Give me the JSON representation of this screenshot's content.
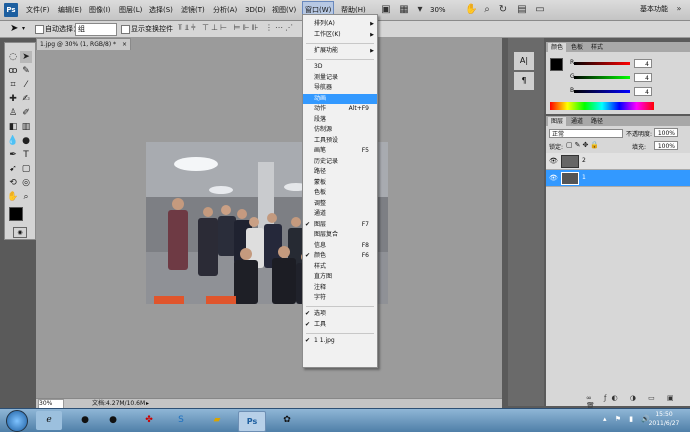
{
  "menubar": {
    "logo": "Ps",
    "items": [
      {
        "label": "文件(F)"
      },
      {
        "label": "编辑(E)"
      },
      {
        "label": "图像(I)"
      },
      {
        "label": "图层(L)"
      },
      {
        "label": "选择(S)"
      },
      {
        "label": "滤镜(T)"
      },
      {
        "label": "分析(A)"
      },
      {
        "label": "3D(D)"
      },
      {
        "label": "视图(V)"
      },
      {
        "label": "窗口(W)",
        "active": true
      },
      {
        "label": "帮助(H)"
      }
    ],
    "zoom": "30%",
    "workspace": "基本功能"
  },
  "options_bar": {
    "auto_select_label": "自动选择：",
    "auto_select_value": "组",
    "show_transform_label": "显示变换控件"
  },
  "document": {
    "tab_title": "1.jpg @ 30% (1, RGB/8) *",
    "zoom_status": "30%",
    "file_info": "文档:4.27M/10.6M"
  },
  "window_menu": {
    "items": [
      {
        "label": "排列(A)",
        "submenu": true
      },
      {
        "label": "工作区(K)",
        "submenu": true
      },
      {
        "separator": true
      },
      {
        "label": "扩展功能",
        "submenu": true
      },
      {
        "separator": true
      },
      {
        "label": "3D"
      },
      {
        "label": "测量记录"
      },
      {
        "label": "导航器"
      },
      {
        "label": "动画",
        "highlighted": true
      },
      {
        "label": "动作",
        "shortcut": "Alt+F9"
      },
      {
        "label": "段落"
      },
      {
        "label": "仿制源"
      },
      {
        "label": "工具预设"
      },
      {
        "label": "画笔",
        "shortcut": "F5"
      },
      {
        "label": "历史记录"
      },
      {
        "label": "路径"
      },
      {
        "label": "蒙板"
      },
      {
        "label": "色板"
      },
      {
        "label": "调整"
      },
      {
        "label": "通道"
      },
      {
        "label": "图层",
        "checked": true,
        "shortcut": "F7"
      },
      {
        "label": "图层复合"
      },
      {
        "label": "信息",
        "shortcut": "F8"
      },
      {
        "label": "颜色",
        "checked": true,
        "shortcut": "F6"
      },
      {
        "label": "样式"
      },
      {
        "label": "直方图"
      },
      {
        "label": "注释"
      },
      {
        "label": "字符"
      },
      {
        "separator": true
      },
      {
        "label": "选项",
        "checked": true
      },
      {
        "label": "工具",
        "checked": true
      },
      {
        "separator": true
      },
      {
        "label": "1 1.jpg",
        "checked": true
      }
    ]
  },
  "color_panel": {
    "tabs": [
      "颜色",
      "色板",
      "样式"
    ],
    "channels": [
      {
        "name": "R",
        "value": "4"
      },
      {
        "name": "G",
        "value": "4"
      },
      {
        "name": "B",
        "value": "4"
      }
    ]
  },
  "layers_panel": {
    "tabs": [
      "图层",
      "通道",
      "路径"
    ],
    "blend_mode": "正常",
    "opacity_label": "不透明度:",
    "opacity_value": "100%",
    "lock_label": "锁定:",
    "fill_label": "填充:",
    "fill_value": "100%",
    "layers": [
      {
        "name": "2",
        "selected": false
      },
      {
        "name": "1",
        "selected": true
      }
    ]
  },
  "taskbar": {
    "time": "15:50",
    "date": "2011/6/27"
  },
  "colors": {
    "highlight": "#3399ff",
    "foreground": "#000000",
    "background": "#ffffff"
  }
}
